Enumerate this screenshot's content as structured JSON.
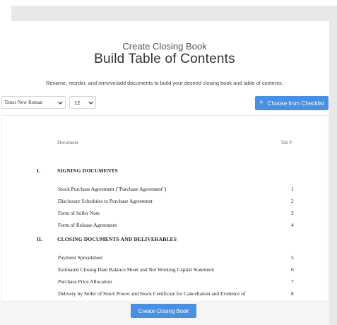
{
  "header": {
    "subtitle": "Create Closing Book",
    "title": "Build Table of Contents",
    "instructions": "Rename, reorder, and remove/add documents to build your desired closing book and table of contents."
  },
  "toolbar": {
    "font_value": "Times New Roman",
    "size_value": "12",
    "checklist_button_label": "Choose from Checklist",
    "checklist_icon": "plus-icon"
  },
  "toc": {
    "col_document": "Document",
    "col_tab": "Tab #",
    "sections": [
      {
        "number": "I.",
        "title": "SIGNING DOCUMENTS",
        "items": [
          {
            "name": "Stock Purchase Agreement (\"Purchase Agreement\")",
            "tab": "1"
          },
          {
            "name": "Disclosure Schedules to Purchase Agreement",
            "tab": "2"
          },
          {
            "name": "Form of Seller Note",
            "tab": "3"
          },
          {
            "name": "Form of Release Agreement",
            "tab": "4"
          }
        ]
      },
      {
        "number": "II.",
        "title": "CLOSING DOCUMENTS AND DELIVERABLES",
        "items": [
          {
            "name": "Payment Spreadsheet",
            "tab": "5"
          },
          {
            "name": "Estimated Closing Date Balance Sheet and Net Working Capital Statement",
            "tab": "6"
          },
          {
            "name": "Purchase Price Allocation",
            "tab": "7"
          },
          {
            "name": "Delivery by Seller of Stock Power and Stock Certificate for Cancellation and Evidence of",
            "tab": "8"
          }
        ]
      }
    ]
  },
  "footer": {
    "create_button_label": "Create Closing Book"
  },
  "colors": {
    "accent": "#4a90e2",
    "band": "#e8e8e8"
  }
}
